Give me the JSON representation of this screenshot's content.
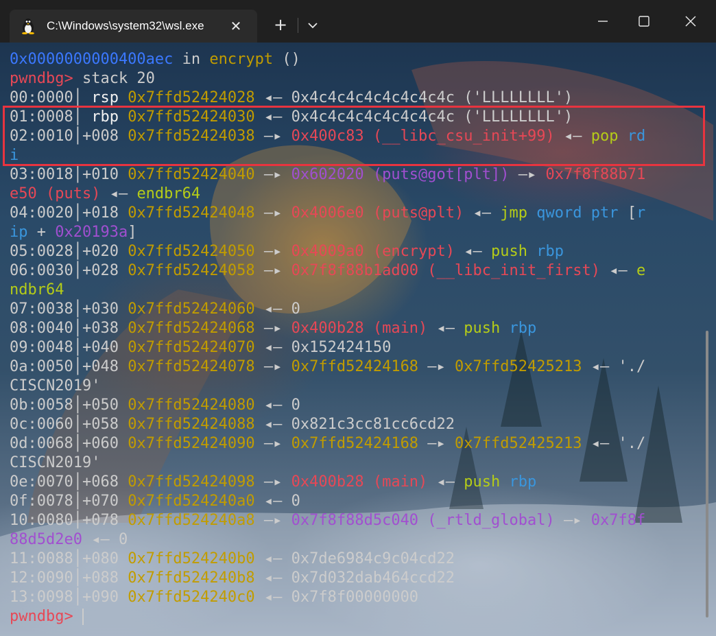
{
  "window": {
    "tab_title": "C:\\Windows\\system32\\wsl.exe",
    "tab_icon": "linux-penguin-icon",
    "new_tab": "+",
    "close_tab": "✕"
  },
  "colors": {
    "blue": "#3b78ff",
    "red": "#e74856",
    "yellow": "#c19c00",
    "green": "#b5cc18",
    "cyan": "#3a96dd",
    "magenta": "#a14fd0",
    "white": "#cccccc",
    "highlight_box": "#e8343f"
  },
  "terminal": {
    "lines": [
      [
        {
          "t": "0x0000000000400aec",
          "c": "blue"
        },
        {
          "t": " in ",
          "c": "white"
        },
        {
          "t": "encrypt",
          "c": "yellow"
        },
        {
          "t": " ()",
          "c": "white"
        }
      ],
      [
        {
          "t": "pwndbg>",
          "c": "red"
        },
        {
          "t": " stack 20",
          "c": "white"
        }
      ],
      [
        {
          "t": "00:0000",
          "c": "white"
        },
        {
          "t": "│ ",
          "c": "sep"
        },
        {
          "t": "rsp ",
          "c": "bright"
        },
        {
          "t": "0x7ffd52424028",
          "c": "yellow"
        },
        {
          "t": " ◂— 0x4c4c4c4c4c4c4c4c ('LLLLLLLL')",
          "c": "white"
        }
      ],
      [
        {
          "t": "01:0008",
          "c": "white"
        },
        {
          "t": "│ ",
          "c": "sep"
        },
        {
          "t": "rbp ",
          "c": "bright"
        },
        {
          "t": "0x7ffd52424030",
          "c": "yellow"
        },
        {
          "t": " ◂— 0x4c4c4c4c4c4c4c4c ('LLLLLLLL')",
          "c": "white"
        }
      ],
      [
        {
          "t": "02:0010",
          "c": "white"
        },
        {
          "t": "│",
          "c": "sep"
        },
        {
          "t": "+008 ",
          "c": "white"
        },
        {
          "t": "0x7ffd52424038",
          "c": "yellow"
        },
        {
          "t": " —▸ ",
          "c": "white"
        },
        {
          "t": "0x400c83 (__libc_csu_init+99)",
          "c": "red"
        },
        {
          "t": " ◂— ",
          "c": "white"
        },
        {
          "t": "pop ",
          "c": "green"
        },
        {
          "t": "rd",
          "c": "cyan"
        }
      ],
      [
        {
          "t": "i",
          "c": "cyan"
        }
      ],
      [
        {
          "t": "03:0018",
          "c": "white"
        },
        {
          "t": "│",
          "c": "sep"
        },
        {
          "t": "+010 ",
          "c": "white"
        },
        {
          "t": "0x7ffd52424040",
          "c": "yellow"
        },
        {
          "t": " —▸ ",
          "c": "white"
        },
        {
          "t": "0x602020 (puts@got[plt])",
          "c": "magenta"
        },
        {
          "t": " —▸ ",
          "c": "white"
        },
        {
          "t": "0x7f8f88b71",
          "c": "red"
        }
      ],
      [
        {
          "t": "e50 (puts)",
          "c": "red"
        },
        {
          "t": " ◂— ",
          "c": "white"
        },
        {
          "t": "endbr64",
          "c": "green"
        }
      ],
      [
        {
          "t": "04:0020",
          "c": "white"
        },
        {
          "t": "│",
          "c": "sep"
        },
        {
          "t": "+018 ",
          "c": "white"
        },
        {
          "t": "0x7ffd52424048",
          "c": "yellow"
        },
        {
          "t": " —▸ ",
          "c": "white"
        },
        {
          "t": "0x4006e0 (puts@plt)",
          "c": "red"
        },
        {
          "t": " ◂— ",
          "c": "white"
        },
        {
          "t": "jmp ",
          "c": "green"
        },
        {
          "t": "qword ptr ",
          "c": "cyan"
        },
        {
          "t": "[",
          "c": "white"
        },
        {
          "t": "r",
          "c": "cyan"
        }
      ],
      [
        {
          "t": "ip",
          "c": "cyan"
        },
        {
          "t": " + ",
          "c": "white"
        },
        {
          "t": "0x20193a",
          "c": "magenta"
        },
        {
          "t": "]",
          "c": "white"
        }
      ],
      [
        {
          "t": "05:0028",
          "c": "white"
        },
        {
          "t": "│",
          "c": "sep"
        },
        {
          "t": "+020 ",
          "c": "white"
        },
        {
          "t": "0x7ffd52424050",
          "c": "yellow"
        },
        {
          "t": " —▸ ",
          "c": "white"
        },
        {
          "t": "0x4009a0 (encrypt)",
          "c": "red"
        },
        {
          "t": " ◂— ",
          "c": "white"
        },
        {
          "t": "push ",
          "c": "green"
        },
        {
          "t": "rbp",
          "c": "cyan"
        }
      ],
      [
        {
          "t": "06:0030",
          "c": "white"
        },
        {
          "t": "│",
          "c": "sep"
        },
        {
          "t": "+028 ",
          "c": "white"
        },
        {
          "t": "0x7ffd52424058",
          "c": "yellow"
        },
        {
          "t": " —▸ ",
          "c": "white"
        },
        {
          "t": "0x7f8f88b1ad00 (__libc_init_first)",
          "c": "red"
        },
        {
          "t": " ◂— ",
          "c": "white"
        },
        {
          "t": "e",
          "c": "green"
        }
      ],
      [
        {
          "t": "ndbr64",
          "c": "green"
        }
      ],
      [
        {
          "t": "07:0038",
          "c": "white"
        },
        {
          "t": "│",
          "c": "sep"
        },
        {
          "t": "+030 ",
          "c": "white"
        },
        {
          "t": "0x7ffd52424060",
          "c": "yellow"
        },
        {
          "t": " ◂— 0",
          "c": "white"
        }
      ],
      [
        {
          "t": "08:0040",
          "c": "white"
        },
        {
          "t": "│",
          "c": "sep"
        },
        {
          "t": "+038 ",
          "c": "white"
        },
        {
          "t": "0x7ffd52424068",
          "c": "yellow"
        },
        {
          "t": " —▸ ",
          "c": "white"
        },
        {
          "t": "0x400b28 (main)",
          "c": "red"
        },
        {
          "t": " ◂— ",
          "c": "white"
        },
        {
          "t": "push ",
          "c": "green"
        },
        {
          "t": "rbp",
          "c": "cyan"
        }
      ],
      [
        {
          "t": "09:0048",
          "c": "white"
        },
        {
          "t": "│",
          "c": "sep"
        },
        {
          "t": "+040 ",
          "c": "white"
        },
        {
          "t": "0x7ffd52424070",
          "c": "yellow"
        },
        {
          "t": " ◂— 0x152424150",
          "c": "white"
        }
      ],
      [
        {
          "t": "0a:0050",
          "c": "white"
        },
        {
          "t": "│",
          "c": "sep"
        },
        {
          "t": "+048 ",
          "c": "white"
        },
        {
          "t": "0x7ffd52424078",
          "c": "yellow"
        },
        {
          "t": " —▸ ",
          "c": "white"
        },
        {
          "t": "0x7ffd52424168",
          "c": "yellow"
        },
        {
          "t": " —▸ ",
          "c": "white"
        },
        {
          "t": "0x7ffd52425213",
          "c": "yellow"
        },
        {
          "t": " ◂— './",
          "c": "white"
        }
      ],
      [
        {
          "t": "CISCN2019'",
          "c": "white"
        }
      ],
      [
        {
          "t": "0b:0058",
          "c": "white"
        },
        {
          "t": "│",
          "c": "sep"
        },
        {
          "t": "+050 ",
          "c": "white"
        },
        {
          "t": "0x7ffd52424080",
          "c": "yellow"
        },
        {
          "t": " ◂— 0",
          "c": "white"
        }
      ],
      [
        {
          "t": "0c:0060",
          "c": "white"
        },
        {
          "t": "│",
          "c": "sep"
        },
        {
          "t": "+058 ",
          "c": "white"
        },
        {
          "t": "0x7ffd52424088",
          "c": "yellow"
        },
        {
          "t": " ◂— 0x821c3cc81cc6cd22",
          "c": "white"
        }
      ],
      [
        {
          "t": "0d:0068",
          "c": "white"
        },
        {
          "t": "│",
          "c": "sep"
        },
        {
          "t": "+060 ",
          "c": "white"
        },
        {
          "t": "0x7ffd52424090",
          "c": "yellow"
        },
        {
          "t": " —▸ ",
          "c": "white"
        },
        {
          "t": "0x7ffd52424168",
          "c": "yellow"
        },
        {
          "t": " —▸ ",
          "c": "white"
        },
        {
          "t": "0x7ffd52425213",
          "c": "yellow"
        },
        {
          "t": " ◂— './",
          "c": "white"
        }
      ],
      [
        {
          "t": "CISCN2019'",
          "c": "white"
        }
      ],
      [
        {
          "t": "0e:0070",
          "c": "white"
        },
        {
          "t": "│",
          "c": "sep"
        },
        {
          "t": "+068 ",
          "c": "white"
        },
        {
          "t": "0x7ffd52424098",
          "c": "yellow"
        },
        {
          "t": " —▸ ",
          "c": "white"
        },
        {
          "t": "0x400b28 (main)",
          "c": "red"
        },
        {
          "t": " ◂— ",
          "c": "white"
        },
        {
          "t": "push ",
          "c": "green"
        },
        {
          "t": "rbp",
          "c": "cyan"
        }
      ],
      [
        {
          "t": "0f:0078",
          "c": "white"
        },
        {
          "t": "│",
          "c": "sep"
        },
        {
          "t": "+070 ",
          "c": "white"
        },
        {
          "t": "0x7ffd524240a0",
          "c": "yellow"
        },
        {
          "t": " ◂— 0",
          "c": "white"
        }
      ],
      [
        {
          "t": "10:0080",
          "c": "white"
        },
        {
          "t": "│",
          "c": "sep"
        },
        {
          "t": "+078 ",
          "c": "white"
        },
        {
          "t": "0x7ffd524240a8",
          "c": "yellow"
        },
        {
          "t": " —▸ ",
          "c": "white"
        },
        {
          "t": "0x7f8f88d5c040 (_rtld_global)",
          "c": "magenta"
        },
        {
          "t": " —▸ ",
          "c": "white"
        },
        {
          "t": "0x7f8f",
          "c": "magenta"
        }
      ],
      [
        {
          "t": "88d5d2e0",
          "c": "magenta"
        },
        {
          "t": " ◂— 0",
          "c": "white"
        }
      ],
      [
        {
          "t": "11:0088",
          "c": "white"
        },
        {
          "t": "│",
          "c": "sep"
        },
        {
          "t": "+080 ",
          "c": "white"
        },
        {
          "t": "0x7ffd524240b0",
          "c": "yellow"
        },
        {
          "t": " ◂— 0x7de6984c9c04cd22",
          "c": "white"
        }
      ],
      [
        {
          "t": "12:0090",
          "c": "white"
        },
        {
          "t": "│",
          "c": "sep"
        },
        {
          "t": "+088 ",
          "c": "white"
        },
        {
          "t": "0x7ffd524240b8",
          "c": "yellow"
        },
        {
          "t": " ◂— 0x7d032dab464ccd22",
          "c": "white"
        }
      ],
      [
        {
          "t": "13:0098",
          "c": "white"
        },
        {
          "t": "│",
          "c": "sep"
        },
        {
          "t": "+090 ",
          "c": "white"
        },
        {
          "t": "0x7ffd524240c0",
          "c": "yellow"
        },
        {
          "t": " ◂— 0x7f8f00000000",
          "c": "white"
        }
      ],
      [
        {
          "t": "pwndbg>",
          "c": "red"
        },
        {
          "t": " ",
          "c": "white"
        }
      ]
    ]
  }
}
